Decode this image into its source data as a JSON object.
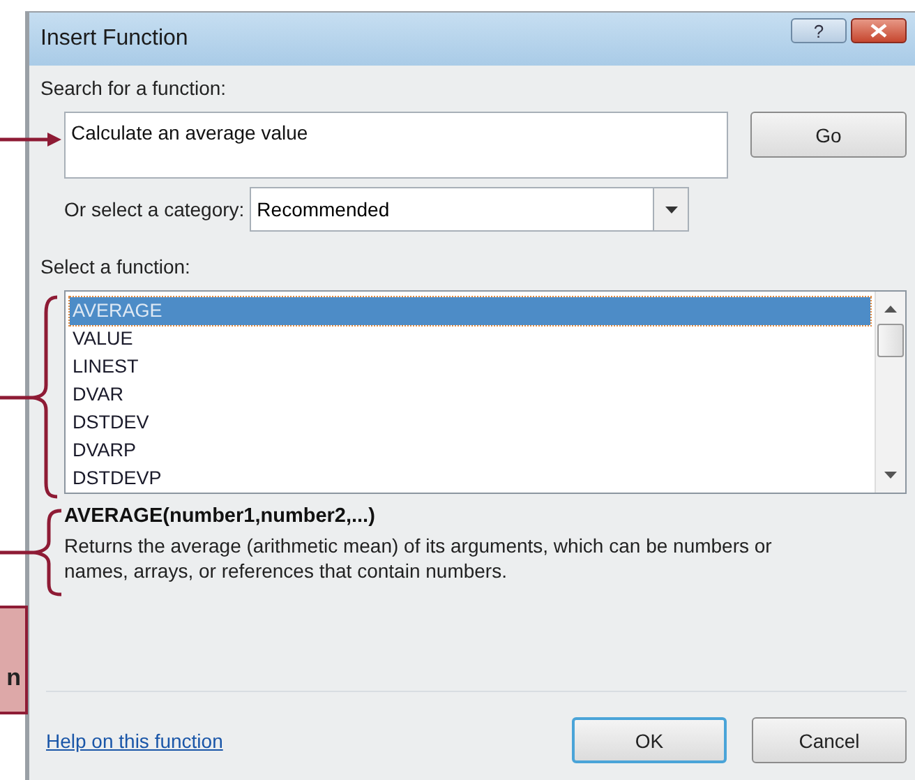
{
  "window": {
    "title": "Insert Function",
    "help_button": "?"
  },
  "search": {
    "label": "Search for a function:",
    "value": "Calculate an average value",
    "button": "Go"
  },
  "category": {
    "label": "Or select a category:",
    "value": "Recommended"
  },
  "functions": {
    "label": "Select a function:",
    "items": [
      {
        "name": "AVERAGE",
        "selected": true
      },
      {
        "name": "VALUE",
        "selected": false
      },
      {
        "name": "LINEST",
        "selected": false
      },
      {
        "name": "DVAR",
        "selected": false
      },
      {
        "name": "DSTDEV",
        "selected": false
      },
      {
        "name": "DVARP",
        "selected": false
      },
      {
        "name": "DSTDEVP",
        "selected": false
      }
    ]
  },
  "signature": "AVERAGE(number1,number2,...)",
  "description": "Returns the average (arithmetic mean) of its arguments, which can be numbers or names, arrays, or references that contain numbers.",
  "help_link": "Help on this function",
  "buttons": [
    "OK",
    "Cancel"
  ],
  "callout": {
    "text": "n"
  }
}
